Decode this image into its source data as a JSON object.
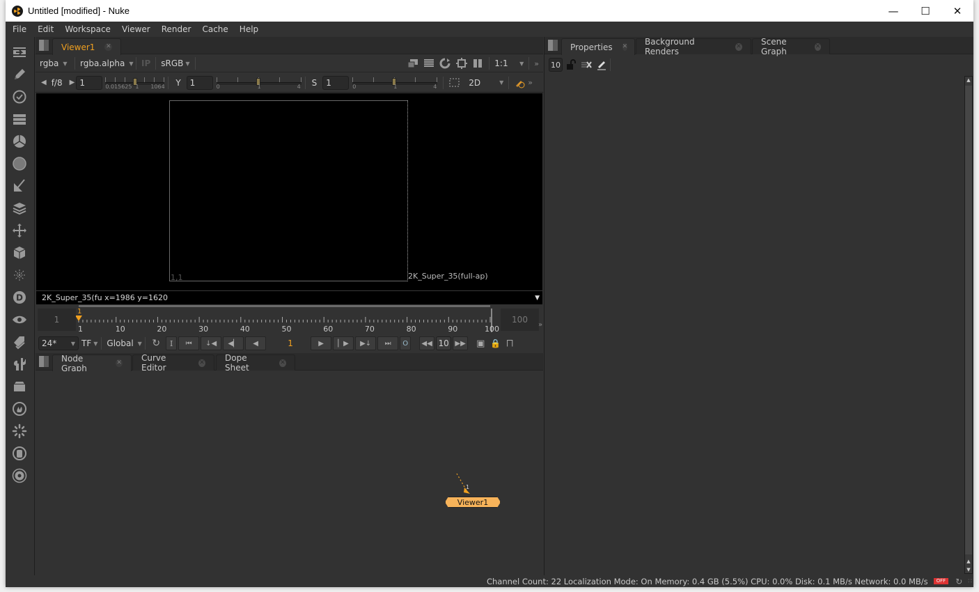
{
  "window": {
    "title": "Untitled [modified] - Nuke",
    "controls": [
      "minimize",
      "maximize",
      "close"
    ]
  },
  "menu": [
    "File",
    "Edit",
    "Workspace",
    "Viewer",
    "Render",
    "Cache",
    "Help"
  ],
  "toolbar_icons": [
    "image-icon",
    "draw-icon",
    "time-icon",
    "channel-icon",
    "color-icon",
    "filter-icon",
    "keyer-icon",
    "merge-icon",
    "transform-icon",
    "3d-icon",
    "particles-icon",
    "deep-icon",
    "views-icon",
    "metadata-icon",
    "toolsets-icon",
    "other-icon",
    "furnace-icon",
    "cara-vr-icon",
    "ocula-icon",
    "nukex-icon"
  ],
  "viewer": {
    "tab_label": "Viewer1",
    "channels": "rgba",
    "display_channel": "rgba.alpha",
    "ip_label": "IP",
    "lut": "sRGB",
    "zoom": "1:1",
    "fstop_label": "f/8",
    "gain_value": "1",
    "gain_slider": {
      "min_label": "0.015625",
      "mid_label": "1",
      "max_label": "1064",
      "value": 1
    },
    "gamma_label": "Y",
    "gamma_value": "1",
    "gamma_slider": {
      "min_label": "0",
      "mid_label": "1",
      "max_label": "4",
      "value": 1
    },
    "saturation_label": "S",
    "saturation_value": "1",
    "saturation_slider": {
      "min_label": "0",
      "mid_label": "1",
      "max_label": "4",
      "value": 1
    },
    "view_mode": "2D",
    "format_bottom_left": "1,1",
    "format_name": "2K_Super_35(full-ap)",
    "info_text": "2K_Super_35(fu  x=1986 y=1620"
  },
  "timeline": {
    "in_frame": "1",
    "out_frame": "100",
    "current_frame_marker": "1",
    "ticks": [
      "1",
      "10",
      "20",
      "30",
      "40",
      "50",
      "60",
      "70",
      "80",
      "90",
      "100"
    ],
    "current_frame": 1,
    "first_frame": 1,
    "last_frame": 100
  },
  "playback": {
    "fps": "24*",
    "timecode_mode": "TF",
    "range_mode": "Global",
    "in_button": "I",
    "out_button": "O",
    "frame_value": "1",
    "skip_increment": "10"
  },
  "bottom_tabs": [
    {
      "label": "Node Graph",
      "active": true
    },
    {
      "label": "Curve Editor",
      "active": false
    },
    {
      "label": "Dope Sheet",
      "active": false
    }
  ],
  "node_graph": {
    "nodes": [
      {
        "name": "Viewer1",
        "color": "#f7b35a",
        "input_label": "1"
      }
    ]
  },
  "right_tabs": [
    {
      "label": "Properties",
      "active": true
    },
    {
      "label": "Background Renders",
      "active": false
    },
    {
      "label": "Scene Graph",
      "active": false
    }
  ],
  "properties": {
    "max_panels": "10"
  },
  "status": {
    "channel_count": "Channel Count: 22",
    "localization": "Localization Mode: On",
    "memory": "Memory: 0.4 GB (5.5%)",
    "cpu": "CPU: 0.0%",
    "disk": "Disk: 0.1 MB/s",
    "network": "Network: 0.0 MB/s",
    "off_badge": "OFF"
  },
  "colors": {
    "accent": "#f0a020",
    "node": "#f7b35a",
    "off_badge": "#dd3333"
  }
}
